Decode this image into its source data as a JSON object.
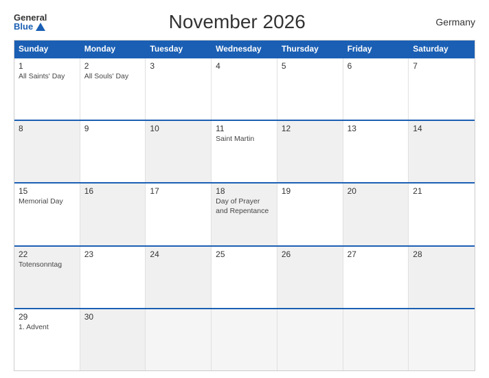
{
  "header": {
    "logo_general": "General",
    "logo_blue": "Blue",
    "title": "November 2026",
    "country": "Germany"
  },
  "weekdays": [
    "Sunday",
    "Monday",
    "Tuesday",
    "Wednesday",
    "Thursday",
    "Friday",
    "Saturday"
  ],
  "rows": [
    [
      {
        "day": "1",
        "holiday": "All Saints' Day",
        "empty": false,
        "gray": false
      },
      {
        "day": "2",
        "holiday": "All Souls' Day",
        "empty": false,
        "gray": false
      },
      {
        "day": "3",
        "holiday": "",
        "empty": false,
        "gray": false
      },
      {
        "day": "4",
        "holiday": "",
        "empty": false,
        "gray": false
      },
      {
        "day": "5",
        "holiday": "",
        "empty": false,
        "gray": false
      },
      {
        "day": "6",
        "holiday": "",
        "empty": false,
        "gray": false
      },
      {
        "day": "7",
        "holiday": "",
        "empty": false,
        "gray": false
      }
    ],
    [
      {
        "day": "8",
        "holiday": "",
        "empty": false,
        "gray": true
      },
      {
        "day": "9",
        "holiday": "",
        "empty": false,
        "gray": false
      },
      {
        "day": "10",
        "holiday": "",
        "empty": false,
        "gray": true
      },
      {
        "day": "11",
        "holiday": "Saint Martin",
        "empty": false,
        "gray": false
      },
      {
        "day": "12",
        "holiday": "",
        "empty": false,
        "gray": true
      },
      {
        "day": "13",
        "holiday": "",
        "empty": false,
        "gray": false
      },
      {
        "day": "14",
        "holiday": "",
        "empty": false,
        "gray": true
      }
    ],
    [
      {
        "day": "15",
        "holiday": "Memorial Day",
        "empty": false,
        "gray": false
      },
      {
        "day": "16",
        "holiday": "",
        "empty": false,
        "gray": true
      },
      {
        "day": "17",
        "holiday": "",
        "empty": false,
        "gray": false
      },
      {
        "day": "18",
        "holiday": "Day of Prayer and Repentance",
        "empty": false,
        "gray": true
      },
      {
        "day": "19",
        "holiday": "",
        "empty": false,
        "gray": false
      },
      {
        "day": "20",
        "holiday": "",
        "empty": false,
        "gray": true
      },
      {
        "day": "21",
        "holiday": "",
        "empty": false,
        "gray": false
      }
    ],
    [
      {
        "day": "22",
        "holiday": "Totensonntag",
        "empty": false,
        "gray": true
      },
      {
        "day": "23",
        "holiday": "",
        "empty": false,
        "gray": false
      },
      {
        "day": "24",
        "holiday": "",
        "empty": false,
        "gray": true
      },
      {
        "day": "25",
        "holiday": "",
        "empty": false,
        "gray": false
      },
      {
        "day": "26",
        "holiday": "",
        "empty": false,
        "gray": true
      },
      {
        "day": "27",
        "holiday": "",
        "empty": false,
        "gray": false
      },
      {
        "day": "28",
        "holiday": "",
        "empty": false,
        "gray": true
      }
    ],
    [
      {
        "day": "29",
        "holiday": "1. Advent",
        "empty": false,
        "gray": false
      },
      {
        "day": "30",
        "holiday": "",
        "empty": false,
        "gray": true
      },
      {
        "day": "",
        "holiday": "",
        "empty": true,
        "gray": false
      },
      {
        "day": "",
        "holiday": "",
        "empty": true,
        "gray": false
      },
      {
        "day": "",
        "holiday": "",
        "empty": true,
        "gray": false
      },
      {
        "day": "",
        "holiday": "",
        "empty": true,
        "gray": false
      },
      {
        "day": "",
        "holiday": "",
        "empty": true,
        "gray": false
      }
    ]
  ]
}
